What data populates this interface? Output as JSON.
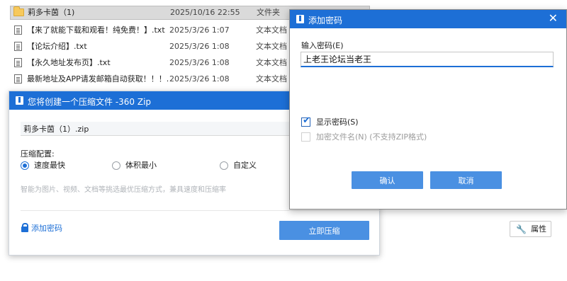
{
  "file_list": [
    {
      "name": "莉多卡茵（1)",
      "date": "2025/10/16 22:55",
      "type": "文件夹",
      "icon": "folder-icon"
    },
    {
      "name": "【来了就能下载和观看！纯免费！】.txt",
      "date": "2025/3/26 1:07",
      "type": "文本文档",
      "icon": "text-file-icon"
    },
    {
      "name": "【论坛介绍】.txt",
      "date": "2025/3/26 1:08",
      "type": "文本文档",
      "icon": "text-file-icon"
    },
    {
      "name": "【永久地址发布页】.txt",
      "date": "2025/3/26 1:08",
      "type": "文本文档",
      "icon": "text-file-icon"
    },
    {
      "name": "最新地址及APP请发邮箱自动获取！！！....",
      "date": "2025/3/26 1:08",
      "type": "文本文档",
      "icon": "text-file-icon"
    }
  ],
  "compress_dialog": {
    "title": "您将创建一个压缩文件 -360 Zip",
    "filename": "莉多卡茵（1）.zip",
    "config_label": "压缩配置:",
    "options": [
      {
        "label": "速度最快",
        "checked": true
      },
      {
        "label": "体积最小",
        "checked": false
      },
      {
        "label": "自定义",
        "checked": false
      }
    ],
    "description": "智能为图片、视频、文档等挑选最优压缩方式，兼具速度和压缩率",
    "add_password_label": "添加密码",
    "compress_button": "立即压缩"
  },
  "password_dialog": {
    "title": "添加密码",
    "close_icon": "close-icon",
    "input_label": "输入密码(E)",
    "password_value": "上老王论坛当老王",
    "show_password_label": "显示密码(S)",
    "show_password_checked": true,
    "encrypt_filename_label": "加密文件名(N)  (不支持ZIP格式)",
    "encrypt_filename_checked": false,
    "ok_button": "确认",
    "cancel_button": "取消"
  },
  "properties_button": {
    "label": "属性",
    "icon": "wrench-icon"
  },
  "colors": {
    "accent": "#1d6fd6",
    "button": "#4a90e2",
    "hint_text": "#b0b4b9"
  }
}
